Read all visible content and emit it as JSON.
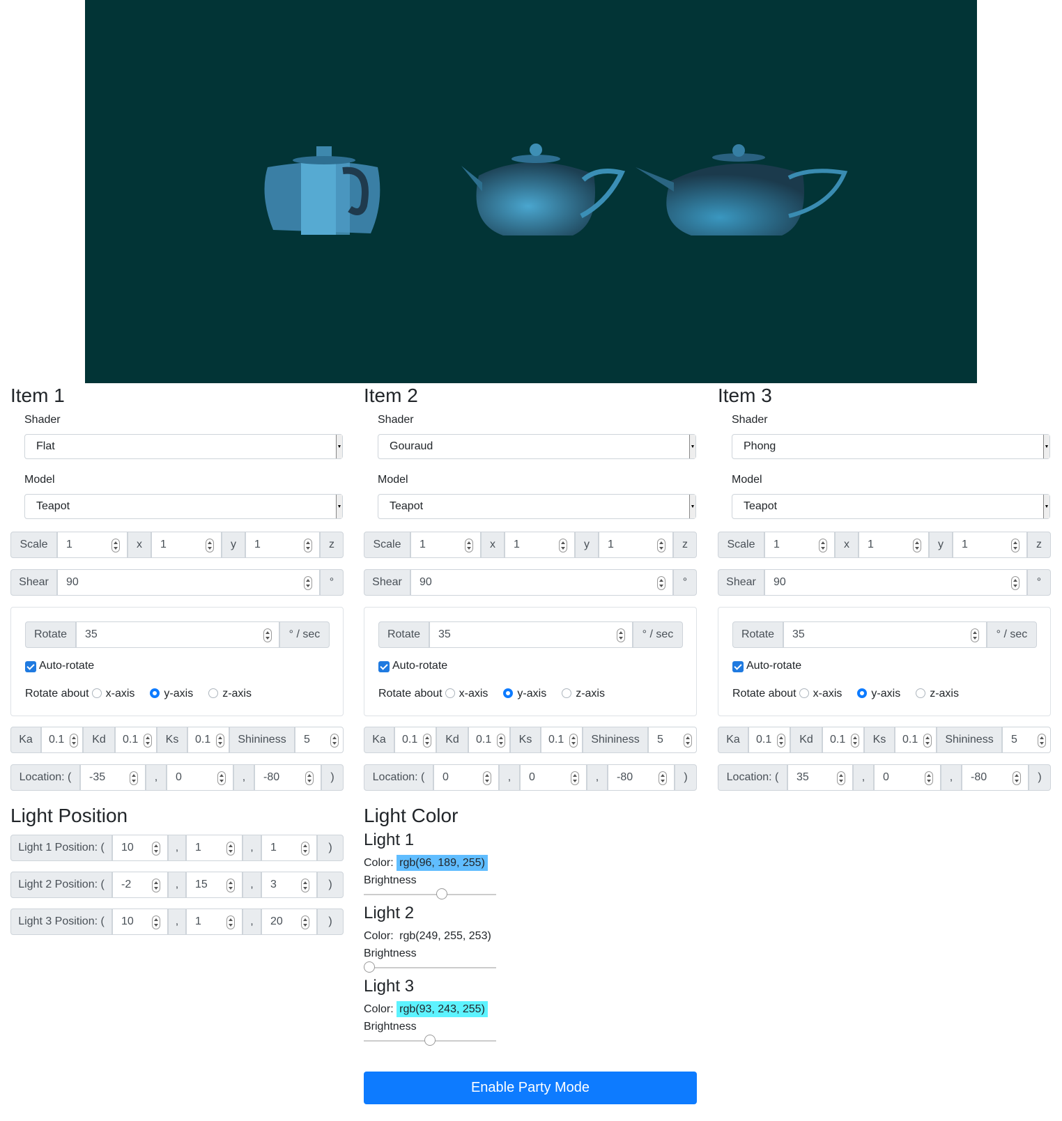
{
  "colors": {
    "canvas_bg": "#023436",
    "teapot": "#3a8fb0",
    "primary": "#0d7bff"
  },
  "items": [
    {
      "title": "Item 1",
      "shader_label": "Shader",
      "shader": "Flat",
      "model_label": "Model",
      "model": "Teapot",
      "scale_label": "Scale",
      "scale": [
        "1",
        "1",
        "1"
      ],
      "axis": [
        "x",
        "y",
        "z"
      ],
      "shear_label": "Shear",
      "shear": "90",
      "deg": "°",
      "rotate_label": "Rotate",
      "rotate": "35",
      "rotate_unit": "° / sec",
      "auto_rotate": "Auto-rotate",
      "rotate_about": "Rotate about",
      "axes": [
        "x-axis",
        "y-axis",
        "z-axis"
      ],
      "ka_label": "Ka",
      "ka": "0.1",
      "kd_label": "Kd",
      "kd": "0.1",
      "ks_label": "Ks",
      "ks": "0.1",
      "shininess_label": "Shininess",
      "shininess": "5",
      "location_label": "Location: (",
      "location": [
        "-35",
        "0",
        "-80"
      ],
      "comma": ",",
      "close": ")"
    },
    {
      "title": "Item 2",
      "shader_label": "Shader",
      "shader": "Gouraud",
      "model_label": "Model",
      "model": "Teapot",
      "scale_label": "Scale",
      "scale": [
        "1",
        "1",
        "1"
      ],
      "axis": [
        "x",
        "y",
        "z"
      ],
      "shear_label": "Shear",
      "shear": "90",
      "deg": "°",
      "rotate_label": "Rotate",
      "rotate": "35",
      "rotate_unit": "° / sec",
      "auto_rotate": "Auto-rotate",
      "rotate_about": "Rotate about",
      "axes": [
        "x-axis",
        "y-axis",
        "z-axis"
      ],
      "ka_label": "Ka",
      "ka": "0.1",
      "kd_label": "Kd",
      "kd": "0.1",
      "ks_label": "Ks",
      "ks": "0.1",
      "shininess_label": "Shininess",
      "shininess": "5",
      "location_label": "Location: (",
      "location": [
        "0",
        "0",
        "-80"
      ],
      "comma": ",",
      "close": ")"
    },
    {
      "title": "Item 3",
      "shader_label": "Shader",
      "shader": "Phong",
      "model_label": "Model",
      "model": "Teapot",
      "scale_label": "Scale",
      "scale": [
        "1",
        "1",
        "1"
      ],
      "axis": [
        "x",
        "y",
        "z"
      ],
      "shear_label": "Shear",
      "shear": "90",
      "deg": "°",
      "rotate_label": "Rotate",
      "rotate": "35",
      "rotate_unit": "° / sec",
      "auto_rotate": "Auto-rotate",
      "rotate_about": "Rotate about",
      "axes": [
        "x-axis",
        "y-axis",
        "z-axis"
      ],
      "ka_label": "Ka",
      "ka": "0.1",
      "kd_label": "Kd",
      "kd": "0.1",
      "ks_label": "Ks",
      "ks": "0.1",
      "shininess_label": "Shininess",
      "shininess": "5",
      "location_label": "Location: (",
      "location": [
        "35",
        "0",
        "-80"
      ],
      "comma": ",",
      "close": ")"
    }
  ],
  "light_position": {
    "title": "Light Position",
    "rows": [
      {
        "label": "Light 1 Position: (",
        "values": [
          "10",
          "1",
          "1"
        ]
      },
      {
        "label": "Light 2 Position: (",
        "values": [
          "-2",
          "15",
          "3"
        ]
      },
      {
        "label": "Light 3 Position: (",
        "values": [
          "10",
          "1",
          "20"
        ]
      }
    ],
    "comma": ",",
    "close": ")"
  },
  "light_color": {
    "title": "Light Color",
    "lights": [
      {
        "title": "Light 1",
        "color_label": "Color:",
        "color": "rgb(96, 189, 255)",
        "swatch": "#60bdff",
        "brightness_label": "Brightness",
        "brightness": 0.6
      },
      {
        "title": "Light 2",
        "color_label": "Color:",
        "color": "rgb(249, 255, 253)",
        "swatch": "#f9fffd",
        "brightness_label": "Brightness",
        "brightness": 0.0
      },
      {
        "title": "Light 3",
        "color_label": "Color:",
        "color": "rgb(93, 243, 255)",
        "swatch": "#5df3ff",
        "brightness_label": "Brightness",
        "brightness": 0.5
      }
    ]
  },
  "party_button": "Enable Party Mode"
}
